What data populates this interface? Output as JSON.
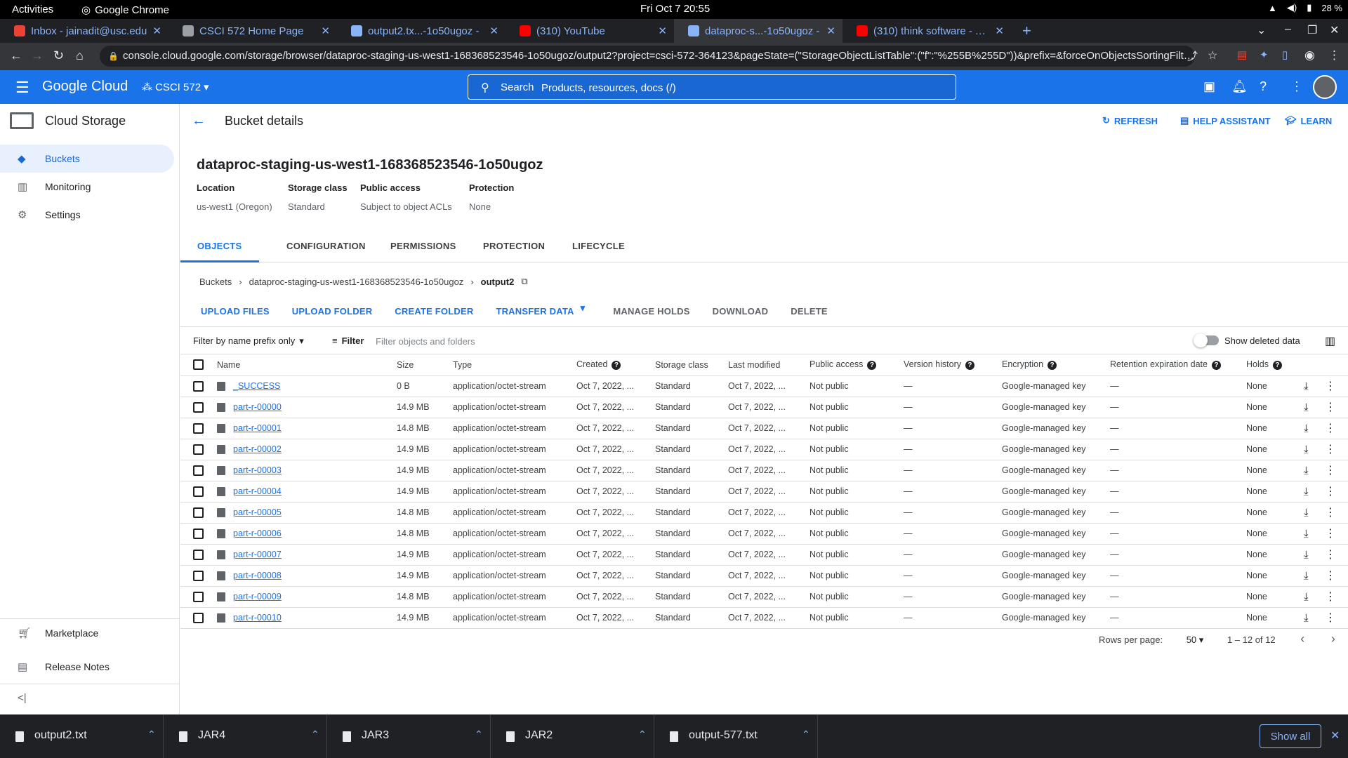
{
  "os": {
    "activities": "Activities",
    "app_name": "Google Chrome",
    "clock": "Fri Oct 7  20:55",
    "battery": "28 %"
  },
  "browser": {
    "tabs": [
      {
        "title": "Inbox - jainadit@usc.edu",
        "icon": "gmail-icon",
        "color": "#ea4335"
      },
      {
        "title": "CSCI 572 Home Page",
        "icon": "globe-icon",
        "color": "#9aa0a6"
      },
      {
        "title": "output2.tx...-1o50ugoz -",
        "icon": "storage-icon",
        "color": "#8ab4f8"
      },
      {
        "title": "(310) YouTube",
        "icon": "youtube-icon",
        "color": "#ff0000"
      },
      {
        "title": "dataproc-s...-1o50ugoz -",
        "icon": "storage-icon",
        "color": "#8ab4f8"
      },
      {
        "title": "(310) think software - You",
        "icon": "youtube-icon",
        "color": "#ff0000"
      }
    ],
    "url": "console.cloud.google.com/storage/browser/dataproc-staging-us-west1-168368523546-1o50ugoz/output2?project=csci-572-364123&pageState=(\"StorageObjectListTable\":(\"f\":\"%255B%255D\"))&prefix=&forceOnObjectsSortingFiltering..."
  },
  "gc_header": {
    "logo": "Google Cloud",
    "project": "CSCI 572",
    "search_label": "Search",
    "search_placeholder": "Products, resources, docs (/)",
    "accent": "#1a73e8"
  },
  "sidebar": {
    "title": "Cloud Storage",
    "items": [
      {
        "label": "Buckets"
      },
      {
        "label": "Monitoring"
      },
      {
        "label": "Settings"
      }
    ],
    "bottom": [
      {
        "label": "Marketplace"
      },
      {
        "label": "Release Notes"
      }
    ],
    "collapse": "<|"
  },
  "page": {
    "title": "Bucket details",
    "refresh": "REFRESH",
    "help": "HELP ASSISTANT",
    "learn": "LEARN",
    "bucket_name": "dataproc-staging-us-west1-168368523546-1o50ugoz",
    "meta": [
      {
        "k": "Location",
        "v": "us-west1 (Oregon)"
      },
      {
        "k": "Storage class",
        "v": "Standard"
      },
      {
        "k": "Public access",
        "v": "Subject to object ACLs"
      },
      {
        "k": "Protection",
        "v": "None"
      }
    ],
    "tabs": [
      "OBJECTS",
      "CONFIGURATION",
      "PERMISSIONS",
      "PROTECTION",
      "LIFECYCLE"
    ],
    "breadcrumb": {
      "root": "Buckets",
      "bucket": "dataproc-staging-us-west1-168368523546-1o50ugoz",
      "folder": "output2"
    },
    "actions": [
      "UPLOAD FILES",
      "UPLOAD FOLDER",
      "CREATE FOLDER",
      "TRANSFER DATA",
      "MANAGE HOLDS",
      "DOWNLOAD",
      "DELETE"
    ],
    "filter_mode": "Filter by name prefix only",
    "filter_label": "Filter",
    "filter_placeholder": "Filter objects and folders",
    "show_deleted": "Show deleted data"
  },
  "table": {
    "headers": [
      "Name",
      "Size",
      "Type",
      "Created",
      "Storage class",
      "Last modified",
      "Public access",
      "Version history",
      "Encryption",
      "Retention expiration date",
      "Holds"
    ],
    "rows": [
      {
        "name": "_SUCCESS",
        "size": "0 B",
        "type": "application/octet-stream",
        "created": "Oct 7, 2022, ...",
        "class": "Standard",
        "modified": "Oct 7, 2022, ...",
        "access": "Not public",
        "version": "—",
        "enc": "Google-managed key",
        "ret": "—",
        "holds": "None"
      },
      {
        "name": "part-r-00000",
        "size": "14.9 MB",
        "type": "application/octet-stream",
        "created": "Oct 7, 2022, ...",
        "class": "Standard",
        "modified": "Oct 7, 2022, ...",
        "access": "Not public",
        "version": "—",
        "enc": "Google-managed key",
        "ret": "—",
        "holds": "None"
      },
      {
        "name": "part-r-00001",
        "size": "14.8 MB",
        "type": "application/octet-stream",
        "created": "Oct 7, 2022, ...",
        "class": "Standard",
        "modified": "Oct 7, 2022, ...",
        "access": "Not public",
        "version": "—",
        "enc": "Google-managed key",
        "ret": "—",
        "holds": "None"
      },
      {
        "name": "part-r-00002",
        "size": "14.9 MB",
        "type": "application/octet-stream",
        "created": "Oct 7, 2022, ...",
        "class": "Standard",
        "modified": "Oct 7, 2022, ...",
        "access": "Not public",
        "version": "—",
        "enc": "Google-managed key",
        "ret": "—",
        "holds": "None"
      },
      {
        "name": "part-r-00003",
        "size": "14.9 MB",
        "type": "application/octet-stream",
        "created": "Oct 7, 2022, ...",
        "class": "Standard",
        "modified": "Oct 7, 2022, ...",
        "access": "Not public",
        "version": "—",
        "enc": "Google-managed key",
        "ret": "—",
        "holds": "None"
      },
      {
        "name": "part-r-00004",
        "size": "14.9 MB",
        "type": "application/octet-stream",
        "created": "Oct 7, 2022, ...",
        "class": "Standard",
        "modified": "Oct 7, 2022, ...",
        "access": "Not public",
        "version": "—",
        "enc": "Google-managed key",
        "ret": "—",
        "holds": "None"
      },
      {
        "name": "part-r-00005",
        "size": "14.8 MB",
        "type": "application/octet-stream",
        "created": "Oct 7, 2022, ...",
        "class": "Standard",
        "modified": "Oct 7, 2022, ...",
        "access": "Not public",
        "version": "—",
        "enc": "Google-managed key",
        "ret": "—",
        "holds": "None"
      },
      {
        "name": "part-r-00006",
        "size": "14.8 MB",
        "type": "application/octet-stream",
        "created": "Oct 7, 2022, ...",
        "class": "Standard",
        "modified": "Oct 7, 2022, ...",
        "access": "Not public",
        "version": "—",
        "enc": "Google-managed key",
        "ret": "—",
        "holds": "None"
      },
      {
        "name": "part-r-00007",
        "size": "14.9 MB",
        "type": "application/octet-stream",
        "created": "Oct 7, 2022, ...",
        "class": "Standard",
        "modified": "Oct 7, 2022, ...",
        "access": "Not public",
        "version": "—",
        "enc": "Google-managed key",
        "ret": "—",
        "holds": "None"
      },
      {
        "name": "part-r-00008",
        "size": "14.9 MB",
        "type": "application/octet-stream",
        "created": "Oct 7, 2022, ...",
        "class": "Standard",
        "modified": "Oct 7, 2022, ...",
        "access": "Not public",
        "version": "—",
        "enc": "Google-managed key",
        "ret": "—",
        "holds": "None"
      },
      {
        "name": "part-r-00009",
        "size": "14.8 MB",
        "type": "application/octet-stream",
        "created": "Oct 7, 2022, ...",
        "class": "Standard",
        "modified": "Oct 7, 2022, ...",
        "access": "Not public",
        "version": "—",
        "enc": "Google-managed key",
        "ret": "—",
        "holds": "None"
      },
      {
        "name": "part-r-00010",
        "size": "14.9 MB",
        "type": "application/octet-stream",
        "created": "Oct 7, 2022, ...",
        "class": "Standard",
        "modified": "Oct 7, 2022, ...",
        "access": "Not public",
        "version": "—",
        "enc": "Google-managed key",
        "ret": "—",
        "holds": "None"
      }
    ]
  },
  "pager": {
    "rows_label": "Rows per page:",
    "rows_value": "50",
    "range": "1 – 12 of 12"
  },
  "downloads": {
    "items": [
      "output2.txt",
      "JAR4",
      "JAR3",
      "JAR2",
      "output-577.txt"
    ],
    "show_all": "Show all"
  }
}
